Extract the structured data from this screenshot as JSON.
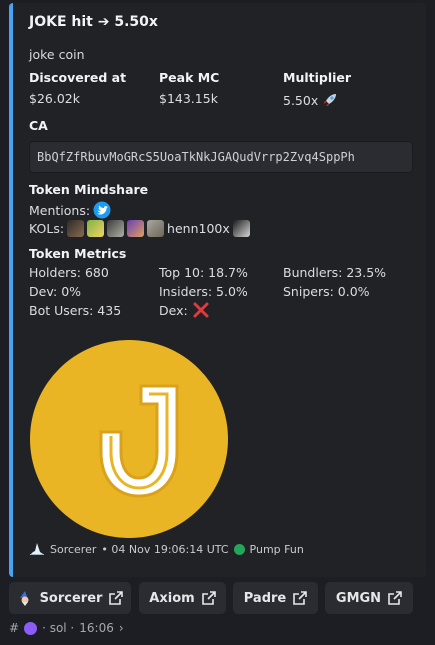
{
  "embed": {
    "title": "JOKE hit ➔ 5.50x",
    "description": "joke coin",
    "accent_color": "#4aa3f2",
    "fields": {
      "discovered_label": "Discovered at",
      "discovered_value": "$26.02k",
      "peak_label": "Peak MC",
      "peak_value": "$143.15k",
      "multiplier_label": "Multiplier",
      "multiplier_value": "5.50x",
      "multiplier_icon": "rocket-icon"
    },
    "ca_label": "CA",
    "ca_value": "BbQfZfRbuvMoGRcS5UoaTkNkJGAQudVrrp2Zvq4SppPh",
    "mindshare": {
      "label": "Token Mindshare",
      "mentions_label": "Mentions:",
      "kols_label": "KOLs:",
      "kol_name": "henn100x"
    },
    "metrics": {
      "label": "Token Metrics",
      "holders": "Holders: 680",
      "top10": "Top 10: 18.7%",
      "bundlers": "Bundlers: 23.5%",
      "dev": "Dev: 0%",
      "insiders": "Insiders: 5.0%",
      "snipers": "Snipers: 0.0%",
      "bot_users": "Bot Users: 435",
      "dex": "Dex:"
    },
    "logo_color": "#e9b524",
    "footer": {
      "bot_name": "Sorcerer",
      "timestamp": "• 04 Nov 19:06:14 UTC",
      "platform": "Pump Fun"
    }
  },
  "buttons": {
    "sorcerer": "Sorcerer",
    "axiom": "Axiom",
    "padre": "Padre",
    "gmgn": "GMGN"
  },
  "message_meta": {
    "hash": "#",
    "chain": "· sol ·",
    "time": "16:06",
    "chevron": "›"
  }
}
